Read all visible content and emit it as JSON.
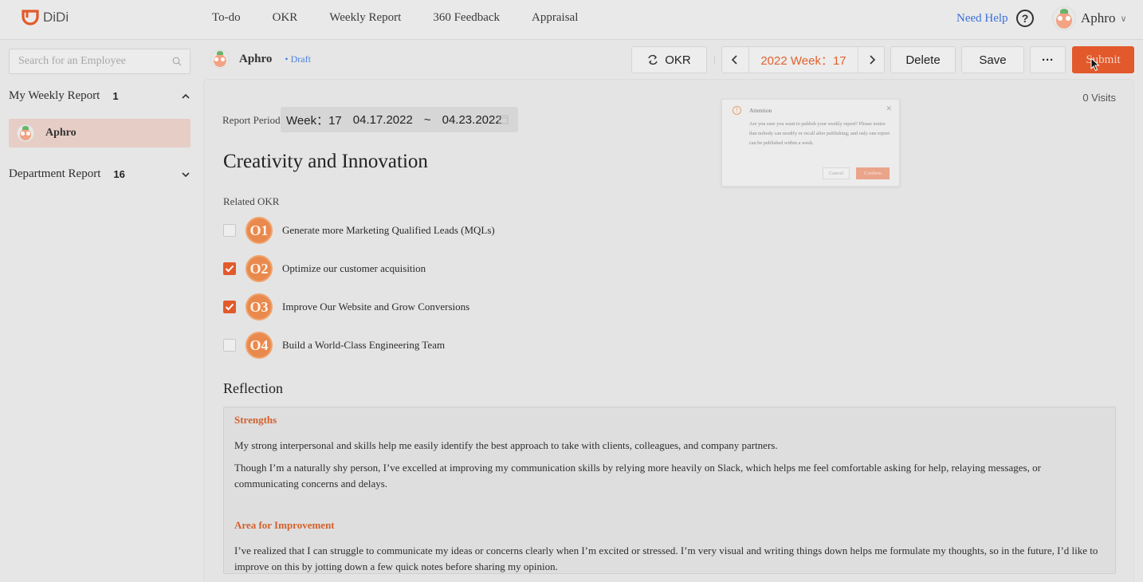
{
  "brand": {
    "name": "DiDi",
    "accent": "#e2592b"
  },
  "nav": {
    "items": [
      "To-do",
      "OKR",
      "Weekly Report",
      "360 Feedback",
      "Appraisal"
    ]
  },
  "header": {
    "help": "Need Help",
    "user": "Aphro"
  },
  "sidebar": {
    "search_placeholder": "Search for an Employee",
    "my_report": {
      "title": "My Weekly Report",
      "count": "1"
    },
    "my_report_item": "Aphro",
    "dept_report": {
      "title": "Department Report",
      "count": "16"
    }
  },
  "toolbar": {
    "user": "Aphro",
    "status": "• Draft",
    "okr_label": "OKR",
    "week_label": "2022 Week：17",
    "delete_label": "Delete",
    "save_label": "Save",
    "more_label": "···",
    "submit_label": "Submit"
  },
  "report": {
    "visits": "0 Visits",
    "period_label": "Report Period",
    "period_week": "Week：17",
    "period_start": "04.17.2022",
    "period_sep": "~",
    "period_end": "04.23.2022",
    "title": "Creativity and Innovation",
    "related_label": "Related OKR",
    "okrs": [
      {
        "badge": "O1",
        "text": "Generate more Marketing Qualified Leads (MQLs)",
        "checked": false
      },
      {
        "badge": "O2",
        "text": "Optimize our customer acquisition",
        "checked": true
      },
      {
        "badge": "O3",
        "text": "Improve Our Website and Grow Conversions",
        "checked": true
      },
      {
        "badge": "O4",
        "text": "Build a World-Class Engineering Team",
        "checked": false
      }
    ],
    "reflection_title": "Reflection",
    "strengths_title": "Strengths",
    "strengths_p1": "My strong interpersonal and skills help me easily identify the best approach to take with clients, colleagues, and company partners.",
    "strengths_p2": "Though I’m a naturally shy person, I’ve excelled at improving my communication skills by relying more heavily on Slack, which helps me feel comfortable asking for help, relaying messages, or communicating concerns and delays.",
    "improve_title": "Area for Improvement",
    "improve_p1": "I’ve realized that I can struggle to communicate my ideas or concerns clearly when I’m excited or stressed. I’m very visual and writing things down helps me formulate my thoughts, so in the future, I’d like to improve on this by jotting down a few quick notes before sharing my opinion."
  },
  "modal": {
    "title": "Attention",
    "body": "Are you sure you want to publish your weekly report? Please notice that nobody can modify or recall after publishing; and only one report can be published within a week.",
    "cancel": "Cancel",
    "confirm": "Confirm"
  }
}
